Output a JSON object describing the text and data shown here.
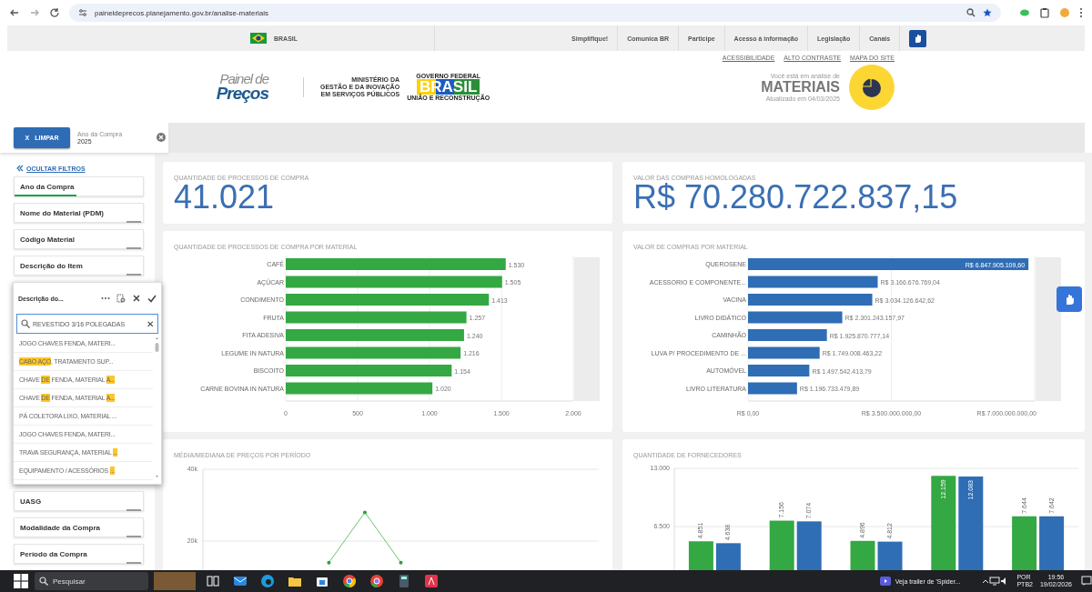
{
  "browser": {
    "url": "paineldeprecos.planejamento.gov.br/analise-materiais"
  },
  "gov_bar": {
    "country": "BRASIL",
    "links": [
      "Simplifique!",
      "Comunica BR",
      "Participe",
      "Acesso à informação",
      "Legislação",
      "Canais"
    ]
  },
  "header": {
    "logo": {
      "line1": "Painel de",
      "line2": "Preços"
    },
    "ministry": [
      "MINISTÉRIO DA",
      "GESTÃO E DA INOVAÇÃO",
      "EM SERVIÇOS PÚBLICOS"
    ],
    "gov_logo": {
      "top": "GOVERNO FEDERAL",
      "word": "BRASIL",
      "bottom": "UNIÃO E RECONSTRUÇÃO"
    },
    "links": [
      "ACESSIBILIDADE",
      "ALTO CONTRASTE",
      "MAPA DO SITE"
    ],
    "context_label": "Você está em análise de",
    "section": "MATERIAIS",
    "updated": "Atualizado em 04/03/2025"
  },
  "selection_bar": {
    "clear_icon": "X",
    "clear_button": "LIMPAR",
    "selections": [
      {
        "field": "Ano da Compra",
        "value": "2025"
      }
    ]
  },
  "sidebar": {
    "toggle": "OCULTAR FILTROS",
    "filters_top": [
      {
        "label": "Ano da Compra",
        "selected": true
      },
      {
        "label": "Nome do Material (PDM)",
        "selected": false
      },
      {
        "label": "Código Material",
        "selected": false
      },
      {
        "label": "Descrição do Item",
        "selected": false
      }
    ],
    "listbox": {
      "title": "Descrição do...",
      "search_value": "REVESTIDO 3/16 POLEGADAS",
      "clear": "✕",
      "items": [
        {
          "parts": [
            {
              "text": "JOGO CHAVES FENDA, MATERI...",
              "highlight": false
            }
          ]
        },
        {
          "parts": [
            {
              "text": "CABO ",
              "highlight": true
            },
            {
              "text": "AÇO",
              "highlight": true
            },
            {
              "text": ", TRATAMENTO SUP...",
              "highlight": false
            }
          ]
        },
        {
          "parts": [
            {
              "text": "CHAVE ",
              "highlight": false
            },
            {
              "text": "DE",
              "highlight": true
            },
            {
              "text": " FENDA, MATERIAL ",
              "highlight": false
            },
            {
              "text": "A...",
              "highlight": true
            }
          ]
        },
        {
          "parts": [
            {
              "text": "CHAVE ",
              "highlight": false
            },
            {
              "text": "DE",
              "highlight": true
            },
            {
              "text": " FENDA, MATERIAL ",
              "highlight": false
            },
            {
              "text": "A...",
              "highlight": true
            }
          ]
        },
        {
          "parts": [
            {
              "text": "PÁ COLETORA LIXO, MATERIAL ...",
              "highlight": false
            }
          ]
        },
        {
          "parts": [
            {
              "text": "JOGO CHAVES FENDA, MATERI...",
              "highlight": false
            }
          ]
        },
        {
          "parts": [
            {
              "text": "TRAVA SEGURANÇA, MATERIAL ",
              "highlight": false
            },
            {
              "text": "...",
              "highlight": true
            }
          ]
        },
        {
          "parts": [
            {
              "text": "EQUIPAMENTO / ACESSÓRIOS ",
              "highlight": false
            },
            {
              "text": "...",
              "highlight": true
            }
          ]
        }
      ]
    },
    "filters_bottom": [
      {
        "label": "UASG",
        "selected": false
      },
      {
        "label": "Modalidade da Compra",
        "selected": false
      },
      {
        "label": "Período da Compra",
        "selected": false
      }
    ]
  },
  "kpis": [
    {
      "label": "QUANTIDADE DE PROCESSOS DE COMPRA",
      "value": "41.021"
    },
    {
      "label": "VALOR DAS COMPRAS HOMOLOGADAS",
      "value": "R$ 70.280.722.837,15"
    }
  ],
  "charts": [
    {
      "title": "QUANTIDADE DE PROCESSOS DE COMPRA POR MATERIAL",
      "chart_data": {
        "type": "bar",
        "orientation": "horizontal",
        "grid": true,
        "categories": [
          "CAFÉ",
          "AÇÚCAR",
          "CONDIMENTO",
          "FRUTA",
          "FITA ADESIVA",
          "LEGUME IN NATURA",
          "BISCOITO",
          "CARNE BOVINA IN NATURA"
        ],
        "series": [
          {
            "color": "#34a843",
            "values": [
              1530,
              1505,
              1413,
              1257,
              1240,
              1216,
              1154,
              1020
            ]
          }
        ],
        "value_labels": [
          "1.530",
          "1.505",
          "1.413",
          "1.257",
          "1.240",
          "1.216",
          "1.154",
          "1.020"
        ],
        "xlim": [
          0,
          2000
        ],
        "xticks": [
          {
            "value": 0,
            "label": "0"
          },
          {
            "value": 500,
            "label": "500"
          },
          {
            "value": 1000,
            "label": "1.000"
          },
          {
            "value": 1500,
            "label": "1.500"
          },
          {
            "value": 2000,
            "label": "2.000"
          }
        ]
      }
    },
    {
      "title": "VALOR DE COMPRAS POR MATERIAL",
      "rows": [
        {
          "label": "QUEROSENE",
          "value": "R$ 6.847.905.109,60"
        },
        {
          "label": "ACESSORIO E COMPONENTE...",
          "value": "R$ 3.166.676.769,04"
        },
        {
          "label": "VACINA",
          "value": "R$ 3.034.126.642,62"
        },
        {
          "label": "LIVRO DIDÁTICO",
          "value": "R$ 2.301.243.157,97"
        },
        {
          "label": "CAMINHÃO",
          "value": "R$ 1.925.870.777,14"
        },
        {
          "label": "LUVA P/ PROCEDIMENTO DE ...",
          "value": "R$ 1.749.008.463,22"
        },
        {
          "label": "AUTOMÓVEL",
          "value": "R$ 1.497.542.413,79"
        },
        {
          "label": "LIVRO LITERATURA",
          "value": "R$ 1.196.733.479,89"
        }
      ],
      "axis_labels": [
        "R$ 0,00",
        "R$ 3.500.000.000,00",
        "R$ 7.000.000.000,00"
      ]
    },
    {
      "title": "MÉDIA/MEDIANA DE PREÇOS POR PERÍODO",
      "chart_data": {
        "type": "line",
        "grid": true,
        "categories": [
          null,
          null,
          null,
          null,
          null,
          null,
          null,
          null,
          null,
          null,
          null
        ],
        "series": [
          {
            "color": "#6cc36f",
            "values": [
              null,
              null,
              null,
              14000,
              28000,
              14000,
              null,
              null,
              null,
              null,
              null
            ]
          }
        ],
        "ylim": [
          0,
          40000
        ],
        "yticks": [
          {
            "value": 20000,
            "label": "20k"
          },
          {
            "value": 40000,
            "label": "40k"
          }
        ]
      }
    },
    {
      "title": "QUANTIDADE DE FORNECEDORES",
      "chart_data": {
        "type": "bar",
        "grid": true,
        "categories": [
          null,
          null,
          null,
          null,
          null
        ],
        "series": [
          {
            "color": "#34a843",
            "values": [
              4851,
              7156,
              4896,
              12159,
              7644
            ]
          },
          {
            "color": "#2f6db5",
            "values": [
              4638,
              7074,
              4812,
              12083,
              7642
            ]
          }
        ],
        "value_labels": [
          [
            "4.851",
            "7.156",
            "4.896",
            "12.159",
            "7.644"
          ],
          [
            "4.638",
            "7.074",
            "4.812",
            "12.083",
            "7.642"
          ]
        ],
        "ylim": [
          0,
          13000
        ],
        "yticks": [
          {
            "value": 6500,
            "label": "6.500"
          },
          {
            "value": 13000,
            "label": "13.000"
          }
        ]
      }
    }
  ],
  "taskbar": {
    "search": "Pesquisar",
    "notification": "Veja trailer de 'Spider...",
    "language": [
      "POR",
      "PTB2"
    ],
    "time": "19:56",
    "date": "19/02/2026"
  }
}
